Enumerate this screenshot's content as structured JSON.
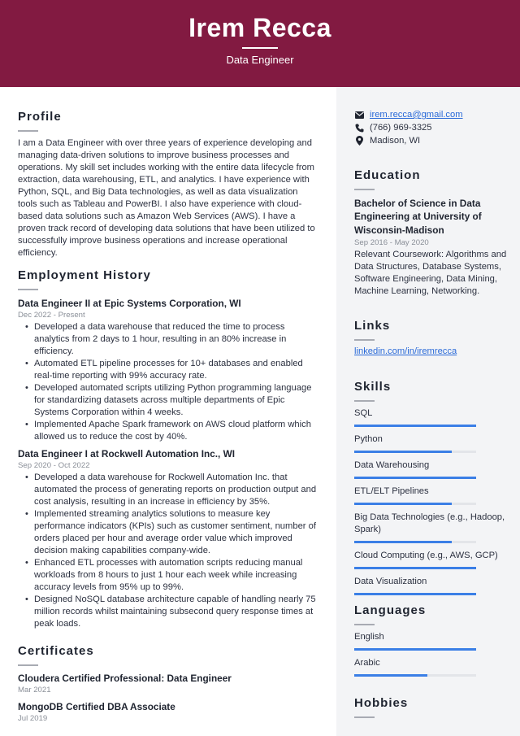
{
  "header": {
    "name": "Irem Recca",
    "role": "Data Engineer",
    "background_color": "#821a41"
  },
  "profile": {
    "title": "Profile",
    "text": "I am a Data Engineer with over three years of experience developing and managing data-driven solutions to improve business processes and operations. My skill set includes working with the entire data lifecycle from extraction, data warehousing, ETL, and analytics. I have experience with Python, SQL, and Big Data technologies, as well as data visualization tools such as Tableau and PowerBI. I also have experience with cloud-based data solutions such as Amazon Web Services (AWS). I have a proven track record of developing data solutions that have been utilized to successfully improve business operations and increase operational efficiency."
  },
  "employment": {
    "title": "Employment History",
    "jobs": [
      {
        "title": "Data Engineer II at Epic Systems Corporation, WI",
        "dates": "Dec 2022 - Present",
        "bullets": [
          "Developed a data warehouse that reduced the time to process analytics from 2 days to 1 hour, resulting in an 80% increase in efficiency.",
          "Automated ETL pipeline processes for 10+ databases and enabled real-time reporting with 99% accuracy rate.",
          "Developed automated scripts utilizing Python programming language for standardizing datasets across multiple departments of Epic Systems Corporation within 4 weeks.",
          "Implemented Apache Spark framework on AWS cloud platform which allowed us to reduce the cost by 40%."
        ]
      },
      {
        "title": "Data Engineer I at Rockwell Automation Inc., WI",
        "dates": "Sep 2020 - Oct 2022",
        "bullets": [
          "Developed a data warehouse for Rockwell Automation Inc. that automated the process of generating reports on production output and cost analysis, resulting in an increase in efficiency by 35%.",
          "Implemented streaming analytics solutions to measure key performance indicators (KPIs) such as customer sentiment, number of orders placed per hour and average order value which improved decision making capabilities company-wide.",
          "Enhanced ETL processes with automation scripts reducing manual workloads from 8 hours to just 1 hour each week while increasing accuracy levels from 95% up to 99%.",
          "Designed NoSQL database architecture capable of handling nearly 75 million records whilst maintaining subsecond query response times at peak loads."
        ]
      }
    ]
  },
  "certificates": {
    "title": "Certificates",
    "items": [
      {
        "name": "Cloudera Certified Professional: Data Engineer",
        "date": "Mar 2021"
      },
      {
        "name": "MongoDB Certified DBA Associate",
        "date": "Jul 2019"
      }
    ]
  },
  "contact": {
    "email": "irem.recca@gmail.com",
    "phone": "(766) 969-3325",
    "location": "Madison, WI",
    "icons": {
      "email": "envelope-icon",
      "phone": "phone-icon",
      "location": "map-pin-icon"
    }
  },
  "education": {
    "title": "Education",
    "degree": "Bachelor of Science in Data Engineering at University of Wisconsin-Madison",
    "dates": "Sep 2016 - May 2020",
    "details": "Relevant Coursework: Algorithms and Data Structures, Database Systems, Software Engineering, Data Mining, Machine Learning, Networking."
  },
  "links": {
    "title": "Links",
    "items": [
      "linkedin.com/in/iremrecca"
    ]
  },
  "skills": {
    "title": "Skills",
    "bar_color": "#3b7fe6",
    "items": [
      {
        "name": "SQL",
        "level": 100
      },
      {
        "name": "Python",
        "level": 80
      },
      {
        "name": "Data Warehousing",
        "level": 100
      },
      {
        "name": "ETL/ELT Pipelines",
        "level": 80
      },
      {
        "name": "Big Data Technologies (e.g., Hadoop, Spark)",
        "level": 80
      },
      {
        "name": "Cloud Computing (e.g., AWS, GCP)",
        "level": 100
      },
      {
        "name": "Data Visualization",
        "level": 100
      }
    ]
  },
  "languages": {
    "title": "Languages",
    "items": [
      {
        "name": "English",
        "level": 100
      },
      {
        "name": "Arabic",
        "level": 60
      }
    ]
  },
  "hobbies": {
    "title": "Hobbies"
  }
}
